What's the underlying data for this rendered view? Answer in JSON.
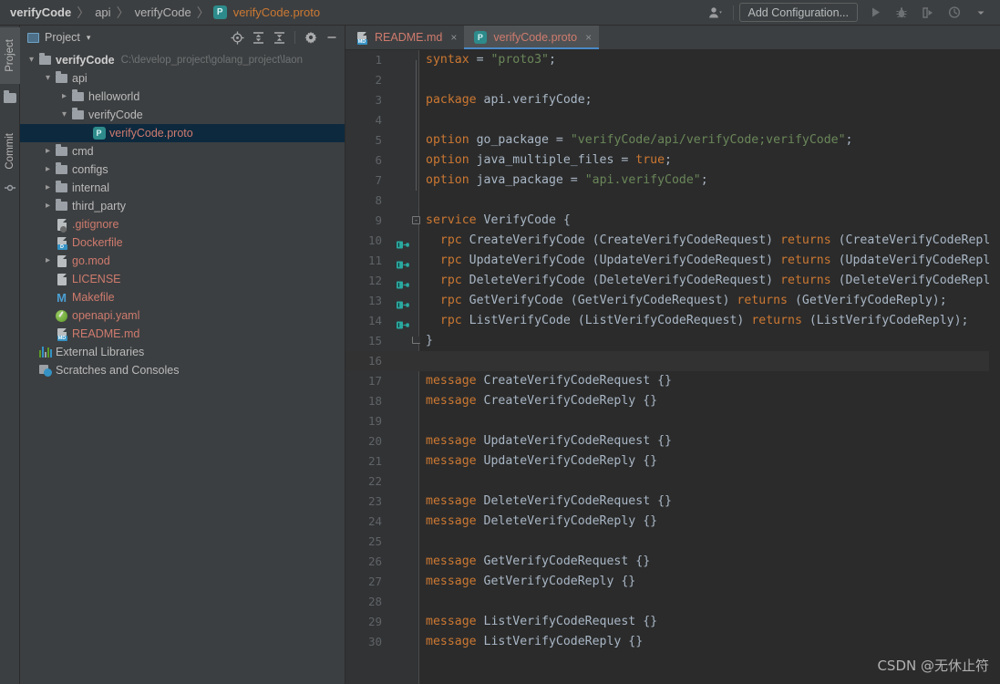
{
  "breadcrumb": {
    "items": [
      {
        "label": "verifyCode",
        "style": "bold"
      },
      {
        "label": "api",
        "style": "normal"
      },
      {
        "label": "verifyCode",
        "style": "normal"
      },
      {
        "label": "verifyCode.proto",
        "style": "file",
        "icon": "proto-file-icon",
        "icon_letter": "P"
      }
    ],
    "separator": "〉"
  },
  "toolbar": {
    "user_icon": "user-account-icon",
    "user_caret": "▾",
    "add_configuration_label": "Add Configuration...",
    "run_icon": "run-icon",
    "debug_icon": "debug-icon",
    "run_with_coverage_icon": "run-with-coverage-icon",
    "profile_icon": "profiler-icon",
    "more_caret": "▾"
  },
  "toolstrip": {
    "project_tab": "Project",
    "commit_tab": "Commit"
  },
  "project_panel": {
    "title": "Project",
    "caret": "▾",
    "tools": [
      {
        "name": "locate-in-tree-icon",
        "glyph": "⊕"
      },
      {
        "name": "expand-all-icon",
        "glyph": "expand"
      },
      {
        "name": "collapse-all-icon",
        "glyph": "collapse"
      },
      {
        "name": "settings-gear-icon",
        "glyph": "gear"
      },
      {
        "name": "hide-panel-icon",
        "glyph": "—"
      }
    ]
  },
  "tree": [
    {
      "label": "verifyCode",
      "hint": "C:\\develop_project\\golang_project\\laon",
      "indent": 0,
      "arrow": "open",
      "icon": "folder-icon",
      "style": "bold",
      "selected": false
    },
    {
      "label": "api",
      "hint": "",
      "indent": 1,
      "arrow": "open",
      "icon": "folder-icon",
      "style": "normal",
      "selected": false
    },
    {
      "label": "helloworld",
      "hint": "",
      "indent": 2,
      "arrow": "closed",
      "icon": "folder-icon",
      "style": "normal",
      "selected": false
    },
    {
      "label": "verifyCode",
      "hint": "",
      "indent": 2,
      "arrow": "open",
      "icon": "folder-icon",
      "style": "normal",
      "selected": false
    },
    {
      "label": "verifyCode.proto",
      "hint": "",
      "indent": 3,
      "arrow": "none",
      "icon": "proto-file-icon",
      "style": "file-red",
      "selected": true
    },
    {
      "label": "cmd",
      "hint": "",
      "indent": 1,
      "arrow": "closed",
      "icon": "folder-icon",
      "style": "normal",
      "selected": false
    },
    {
      "label": "configs",
      "hint": "",
      "indent": 1,
      "arrow": "closed",
      "icon": "folder-icon",
      "style": "normal",
      "selected": false
    },
    {
      "label": "internal",
      "hint": "",
      "indent": 1,
      "arrow": "closed",
      "icon": "folder-icon",
      "style": "normal",
      "selected": false
    },
    {
      "label": "third_party",
      "hint": "",
      "indent": 1,
      "arrow": "closed",
      "icon": "folder-icon",
      "style": "normal",
      "selected": false
    },
    {
      "label": ".gitignore",
      "hint": "",
      "indent": 1,
      "arrow": "none",
      "icon": "gitignore-file-icon",
      "style": "file-red",
      "selected": false
    },
    {
      "label": "Dockerfile",
      "hint": "",
      "indent": 1,
      "arrow": "none",
      "icon": "dockerfile-icon",
      "style": "file-red",
      "selected": false
    },
    {
      "label": "go.mod",
      "hint": "",
      "indent": 1,
      "arrow": "closed",
      "icon": "go-mod-file-icon",
      "style": "file-red",
      "selected": false
    },
    {
      "label": "LICENSE",
      "hint": "",
      "indent": 1,
      "arrow": "none",
      "icon": "text-file-icon",
      "style": "file-red",
      "selected": false
    },
    {
      "label": "Makefile",
      "hint": "",
      "indent": 1,
      "arrow": "none",
      "icon": "makefile-icon",
      "style": "file-red",
      "selected": false
    },
    {
      "label": "openapi.yaml",
      "hint": "",
      "indent": 1,
      "arrow": "none",
      "icon": "yaml-file-icon",
      "style": "file-red",
      "selected": false
    },
    {
      "label": "README.md",
      "hint": "",
      "indent": 1,
      "arrow": "none",
      "icon": "markdown-file-icon",
      "style": "file-red",
      "selected": false
    },
    {
      "label": "External Libraries",
      "hint": "",
      "indent": 0,
      "arrow": "none",
      "icon": "external-libraries-icon",
      "style": "normal",
      "selected": false
    },
    {
      "label": "Scratches and Consoles",
      "hint": "",
      "indent": 0,
      "arrow": "none",
      "icon": "scratches-icon",
      "style": "normal",
      "selected": false
    }
  ],
  "editor_tabs": [
    {
      "label": "README.md",
      "icon": "markdown-file-icon",
      "active": false,
      "close": "×"
    },
    {
      "label": "verifyCode.proto",
      "icon": "proto-file-icon",
      "active": true,
      "close": "×"
    }
  ],
  "code": {
    "language": "protobuf",
    "lines": [
      {
        "n": 1,
        "segments": [
          {
            "t": "syntax",
            "c": "kw"
          },
          {
            "t": " = ",
            "c": "op"
          },
          {
            "t": "\"proto3\"",
            "c": "str"
          },
          {
            "t": ";",
            "c": "op"
          }
        ]
      },
      {
        "n": 2,
        "segments": []
      },
      {
        "n": 3,
        "segments": [
          {
            "t": "package",
            "c": "kw"
          },
          {
            "t": " api.verifyCode;",
            "c": "ident"
          }
        ]
      },
      {
        "n": 4,
        "segments": []
      },
      {
        "n": 5,
        "segments": [
          {
            "t": "option",
            "c": "kw"
          },
          {
            "t": " go_package ",
            "c": "ident"
          },
          {
            "t": "= ",
            "c": "op"
          },
          {
            "t": "\"verifyCode/api/verifyCode;verifyCode\"",
            "c": "str"
          },
          {
            "t": ";",
            "c": "op"
          }
        ]
      },
      {
        "n": 6,
        "segments": [
          {
            "t": "option",
            "c": "kw"
          },
          {
            "t": " java_multiple_files ",
            "c": "ident"
          },
          {
            "t": "= ",
            "c": "op"
          },
          {
            "t": "true",
            "c": "kw"
          },
          {
            "t": ";",
            "c": "op"
          }
        ]
      },
      {
        "n": 7,
        "segments": [
          {
            "t": "option",
            "c": "kw"
          },
          {
            "t": " java_package ",
            "c": "ident"
          },
          {
            "t": "= ",
            "c": "op"
          },
          {
            "t": "\"api.verifyCode\"",
            "c": "str"
          },
          {
            "t": ";",
            "c": "op"
          }
        ]
      },
      {
        "n": 8,
        "segments": []
      },
      {
        "n": 9,
        "segments": [
          {
            "t": "service",
            "c": "kw"
          },
          {
            "t": " VerifyCode {",
            "c": "ident"
          }
        ],
        "fold": "start"
      },
      {
        "n": 10,
        "segments": [
          {
            "t": "  ",
            "c": "op"
          },
          {
            "t": "rpc",
            "c": "kw"
          },
          {
            "t": " CreateVerifyCode (CreateVerifyCodeRequest) ",
            "c": "ident"
          },
          {
            "t": "returns",
            "c": "kw"
          },
          {
            "t": " (CreateVerifyCodeReply);",
            "c": "ident"
          }
        ],
        "rpc_marker": true
      },
      {
        "n": 11,
        "segments": [
          {
            "t": "  ",
            "c": "op"
          },
          {
            "t": "rpc",
            "c": "kw"
          },
          {
            "t": " UpdateVerifyCode (UpdateVerifyCodeRequest) ",
            "c": "ident"
          },
          {
            "t": "returns",
            "c": "kw"
          },
          {
            "t": " (UpdateVerifyCodeReply);",
            "c": "ident"
          }
        ],
        "rpc_marker": true
      },
      {
        "n": 12,
        "segments": [
          {
            "t": "  ",
            "c": "op"
          },
          {
            "t": "rpc",
            "c": "kw"
          },
          {
            "t": " DeleteVerifyCode (DeleteVerifyCodeRequest) ",
            "c": "ident"
          },
          {
            "t": "returns",
            "c": "kw"
          },
          {
            "t": " (DeleteVerifyCodeReply);",
            "c": "ident"
          }
        ],
        "rpc_marker": true
      },
      {
        "n": 13,
        "segments": [
          {
            "t": "  ",
            "c": "op"
          },
          {
            "t": "rpc",
            "c": "kw"
          },
          {
            "t": " GetVerifyCode (GetVerifyCodeRequest) ",
            "c": "ident"
          },
          {
            "t": "returns",
            "c": "kw"
          },
          {
            "t": " (GetVerifyCodeReply);",
            "c": "ident"
          }
        ],
        "rpc_marker": true
      },
      {
        "n": 14,
        "segments": [
          {
            "t": "  ",
            "c": "op"
          },
          {
            "t": "rpc",
            "c": "kw"
          },
          {
            "t": " ListVerifyCode (ListVerifyCodeRequest) ",
            "c": "ident"
          },
          {
            "t": "returns",
            "c": "kw"
          },
          {
            "t": " (ListVerifyCodeReply);",
            "c": "ident"
          }
        ],
        "rpc_marker": true
      },
      {
        "n": 15,
        "segments": [
          {
            "t": "}",
            "c": "ident"
          }
        ],
        "fold": "end"
      },
      {
        "n": 16,
        "segments": [],
        "cursor": true
      },
      {
        "n": 17,
        "segments": [
          {
            "t": "message",
            "c": "kw"
          },
          {
            "t": " CreateVerifyCodeRequest {}",
            "c": "ident"
          }
        ]
      },
      {
        "n": 18,
        "segments": [
          {
            "t": "message",
            "c": "kw"
          },
          {
            "t": " CreateVerifyCodeReply {}",
            "c": "ident"
          }
        ]
      },
      {
        "n": 19,
        "segments": []
      },
      {
        "n": 20,
        "segments": [
          {
            "t": "message",
            "c": "kw"
          },
          {
            "t": " UpdateVerifyCodeRequest {}",
            "c": "ident"
          }
        ]
      },
      {
        "n": 21,
        "segments": [
          {
            "t": "message",
            "c": "kw"
          },
          {
            "t": " UpdateVerifyCodeReply {}",
            "c": "ident"
          }
        ]
      },
      {
        "n": 22,
        "segments": []
      },
      {
        "n": 23,
        "segments": [
          {
            "t": "message",
            "c": "kw"
          },
          {
            "t": " DeleteVerifyCodeRequest {}",
            "c": "ident"
          }
        ]
      },
      {
        "n": 24,
        "segments": [
          {
            "t": "message",
            "c": "kw"
          },
          {
            "t": " DeleteVerifyCodeReply {}",
            "c": "ident"
          }
        ]
      },
      {
        "n": 25,
        "segments": []
      },
      {
        "n": 26,
        "segments": [
          {
            "t": "message",
            "c": "kw"
          },
          {
            "t": " GetVerifyCodeRequest {}",
            "c": "ident"
          }
        ]
      },
      {
        "n": 27,
        "segments": [
          {
            "t": "message",
            "c": "kw"
          },
          {
            "t": " GetVerifyCodeReply {}",
            "c": "ident"
          }
        ]
      },
      {
        "n": 28,
        "segments": []
      },
      {
        "n": 29,
        "segments": [
          {
            "t": "message",
            "c": "kw"
          },
          {
            "t": " ListVerifyCodeRequest {}",
            "c": "ident"
          }
        ]
      },
      {
        "n": 30,
        "segments": [
          {
            "t": "message",
            "c": "kw"
          },
          {
            "t": " ListVerifyCodeReply {}",
            "c": "ident"
          }
        ]
      }
    ]
  },
  "watermark": "CSDN @无休止符",
  "colors": {
    "background": "#3c3f41",
    "editor_background": "#2b2b2b",
    "gutter_background": "#313335",
    "keyword": "#cc7832",
    "string": "#6a8759",
    "identifier": "#a9b7c6",
    "line_number": "#606366",
    "selection": "#0d293e",
    "tab_underline": "#4a88c7",
    "file_red": "#cf7b6e",
    "proto_badge": "#2e8b8b"
  }
}
